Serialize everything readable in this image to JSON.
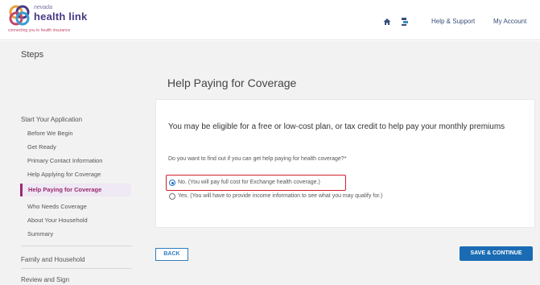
{
  "header": {
    "logo_small": "nevada",
    "logo_main": "health link",
    "logo_tagline": "connecting you to health insurance",
    "home_icon": "home-icon",
    "tool_icon": "accessibility-icon",
    "help_link": "Help & Support",
    "account_link": "My Account"
  },
  "sidebar": {
    "title": "Steps",
    "section_start": "Start Your Application",
    "items": [
      "Before We Begin",
      "Get Ready",
      "Primary Contact Information",
      "Help Applying for Coverage",
      "Help Paying for Coverage",
      "Who Needs Coverage",
      "About Your Household",
      "Summary"
    ],
    "section_family": "Family and Household",
    "section_review": "Review and Sign"
  },
  "main": {
    "title": "Help Paying for Coverage",
    "heading": "You may be eligible for a free or low-cost plan, or tax credit to help pay your monthly premiums",
    "question": "Do you want to find out if you can get help paying for health coverage?*",
    "option_no": "No. (You will pay full cost for Exchange health coverage.)",
    "option_yes": "Yes. (You will have to provide income information to see what you may qualify for.)",
    "selected": "No"
  },
  "buttons": {
    "back": "BACK",
    "save": "SAVE & CONTINUE"
  },
  "colors": {
    "brand_purple": "#4a3a86",
    "active_magenta": "#9b2a6f",
    "primary_blue": "#1a6bb3",
    "highlight_red": "#d2202a"
  }
}
